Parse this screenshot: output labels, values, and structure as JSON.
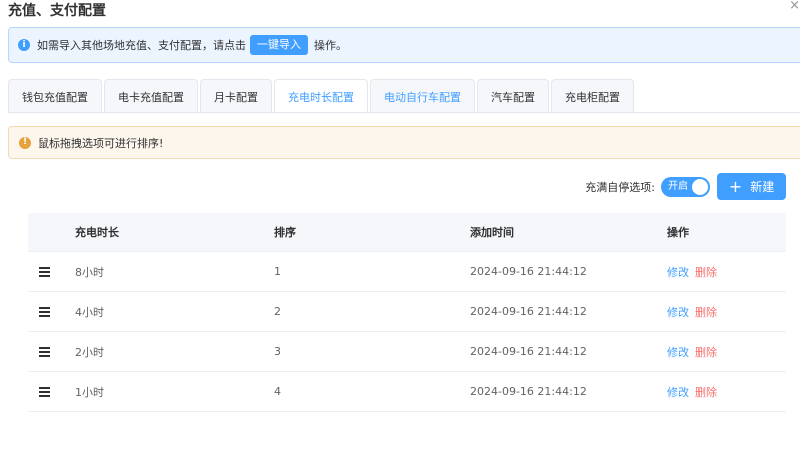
{
  "dialog": {
    "title": "充值、支付配置",
    "close_label": "×"
  },
  "info_alert": {
    "prefix": "如需导入其他场地充值、支付配置，请点击",
    "button": "一键导入",
    "suffix": "操作。"
  },
  "tabs": [
    {
      "label": "钱包充值配置"
    },
    {
      "label": "电卡充值配置"
    },
    {
      "label": "月卡配置"
    },
    {
      "label": "充电时长配置"
    },
    {
      "label": "电动自行车配置"
    },
    {
      "label": "汽车配置"
    },
    {
      "label": "充电柜配置"
    }
  ],
  "active_tab": "充电时长配置",
  "warn_alert": {
    "text": "鼠标拖拽选项可进行排序!"
  },
  "toolbar": {
    "auto_stop_label": "充满自停选项:",
    "switch_label": "开启",
    "switch_on": true,
    "new_button": "新建"
  },
  "table": {
    "headers": [
      "充电时长",
      "排序",
      "添加时间",
      "操作"
    ],
    "rows": [
      {
        "duration": "8小时",
        "order": "1",
        "time": "2024-09-16 21:44:12"
      },
      {
        "duration": "4小时",
        "order": "2",
        "time": "2024-09-16 21:44:12"
      },
      {
        "duration": "2小时",
        "order": "3",
        "time": "2024-09-16 21:44:12"
      },
      {
        "duration": "1小时",
        "order": "4",
        "time": "2024-09-16 21:44:12"
      }
    ],
    "edit_label": "修改",
    "delete_label": "删除"
  },
  "colors": {
    "primary": "#409eff",
    "danger": "#f56c6c",
    "warning": "#e6a23c",
    "info_bg": "#ecf5ff",
    "warn_bg": "#fdf6ec"
  }
}
